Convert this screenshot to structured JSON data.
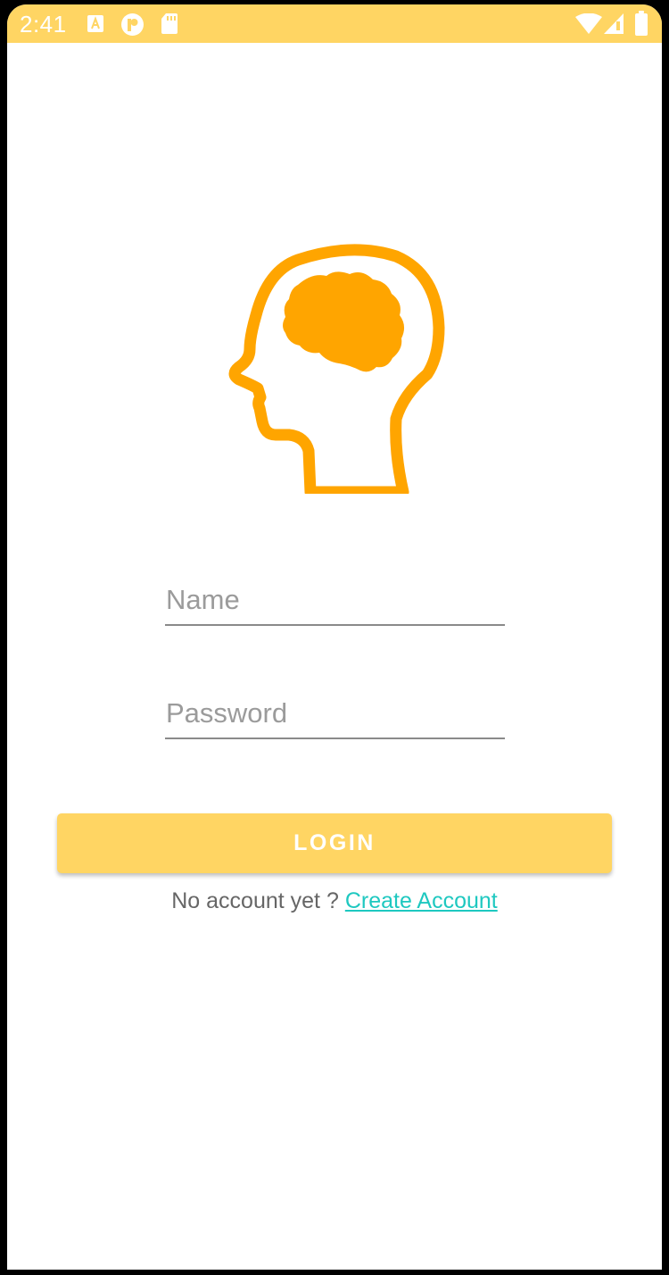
{
  "status_bar": {
    "time": "2:41",
    "background_color": "#FFD563",
    "left_icons": [
      "app-a-icon",
      "app-p-icon",
      "sd-card-icon"
    ],
    "right_icons": [
      "wifi-icon",
      "cell-signal-icon",
      "battery-icon"
    ]
  },
  "logo": {
    "icon": "head-brain-icon",
    "color": "#FFA500"
  },
  "form": {
    "name_placeholder": "Name",
    "name_value": "",
    "password_placeholder": "Password",
    "password_value": "",
    "login_label": "LOGIN",
    "button_color": "#FFD563"
  },
  "signup": {
    "prompt": "No account yet ?",
    "link_label": "Create Account",
    "link_color": "#1EC8C0"
  }
}
